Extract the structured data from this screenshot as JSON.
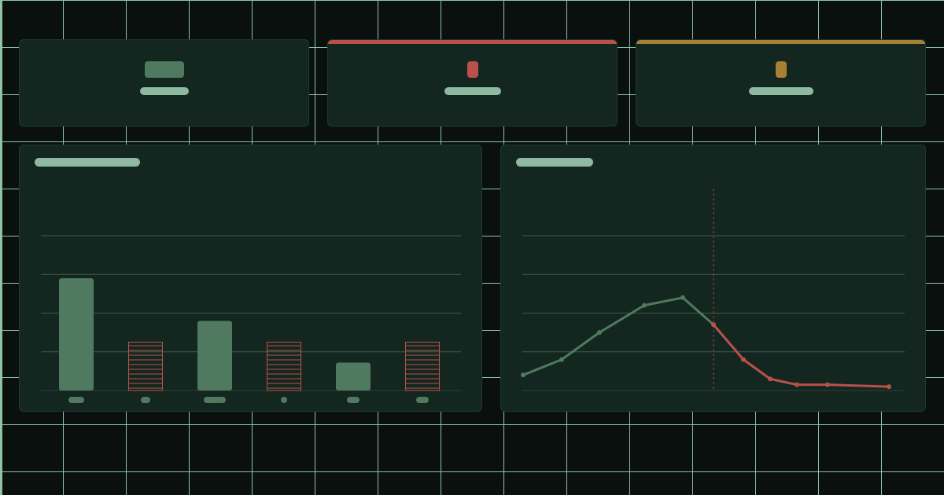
{
  "colors": {
    "normal": "#4f7a5f",
    "alert": "#b9514a",
    "warning": "#a88033",
    "label": "#8fb9a1",
    "grid": "#3e5a4c"
  },
  "stats": [
    {
      "status": "normal"
    },
    {
      "status": "alert"
    },
    {
      "status": "warning"
    }
  ],
  "chart_data": [
    {
      "type": "bar",
      "title": "",
      "categories": [
        "",
        "",
        "",
        "",
        "",
        ""
      ],
      "values": [
        2.9,
        1.25,
        1.8,
        1.25,
        0.72,
        1.25
      ],
      "status": [
        "normal",
        "alert",
        "normal",
        "alert",
        "normal",
        "alert"
      ],
      "ylim": [
        0,
        4
      ],
      "grid": true
    },
    {
      "type": "line",
      "title": "",
      "x": [
        0,
        1,
        2,
        3,
        4,
        5,
        6,
        7,
        8,
        9,
        10
      ],
      "values": [
        0.4,
        0.8,
        1.5,
        2.2,
        2.4,
        1.7,
        0.8,
        0.3,
        0.15,
        0.15,
        0.1
      ],
      "threshold_index": 5,
      "segments": [
        {
          "status": "normal",
          "from": 0,
          "to": 5
        },
        {
          "status": "alert",
          "from": 5,
          "to": 10
        }
      ],
      "ylim": [
        0,
        4
      ],
      "grid": true
    }
  ]
}
